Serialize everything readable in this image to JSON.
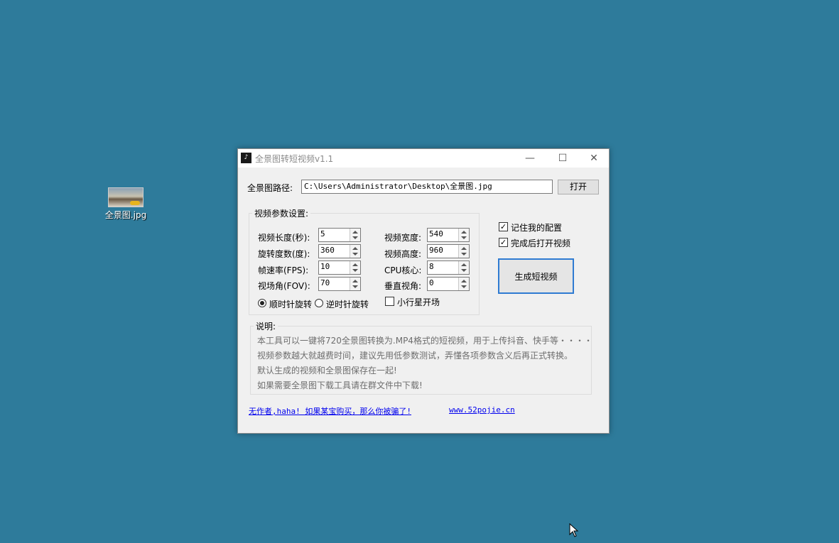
{
  "desktop": {
    "icon_label": "全景图.jpg"
  },
  "window": {
    "title": "全景图转短视频v1.1",
    "controls": {
      "minimize": "—",
      "maximize": "☐",
      "close": "✕"
    }
  },
  "path": {
    "label": "全景图路径:",
    "value": "C:\\Users\\Administrator\\Desktop\\全景图.jpg",
    "open_button": "打开"
  },
  "params": {
    "group_title": "视频参数设置:",
    "left": [
      {
        "label": "视频长度(秒):",
        "value": "5"
      },
      {
        "label": "旋转度数(度):",
        "value": "360"
      },
      {
        "label": "帧速率(FPS):",
        "value": "10"
      },
      {
        "label": "视场角(FOV):",
        "value": "70"
      }
    ],
    "right": [
      {
        "label": "视频宽度:",
        "value": "540"
      },
      {
        "label": "视频高度:",
        "value": "960"
      },
      {
        "label": "CPU核心:",
        "value": "8"
      },
      {
        "label": "垂直视角:",
        "value": "0"
      }
    ],
    "radio_clockwise": "顺时针旋转",
    "radio_counter": "逆时针旋转",
    "clockwise_selected": true,
    "planet_label": "小行星开场",
    "planet_checked": false
  },
  "options": {
    "remember_label": "记住我的配置",
    "remember_checked": true,
    "open_after_label": "完成后打开视频",
    "open_after_checked": true,
    "generate_button": "生成短视频"
  },
  "description": {
    "title": "说明:",
    "lines": [
      "本工具可以一键将720全景图转换为.MP4格式的短视频，用于上传抖音、快手等・・・・",
      "视频参数越大就越费时间，建议先用低参数测试，弄懂各项参数含义后再正式转换。",
      "默认生成的视频和全景图保存在一起!",
      "如果需要全景图下载工具请在群文件中下载!"
    ]
  },
  "links": {
    "author": "无作者,haha! 如果某宝购买，那么你被骗了!",
    "site": "www.52pojie.cn"
  },
  "colors": {
    "desktop": "#2e7b9b",
    "accent": "#2f7bd2",
    "link": "#0000ee"
  }
}
